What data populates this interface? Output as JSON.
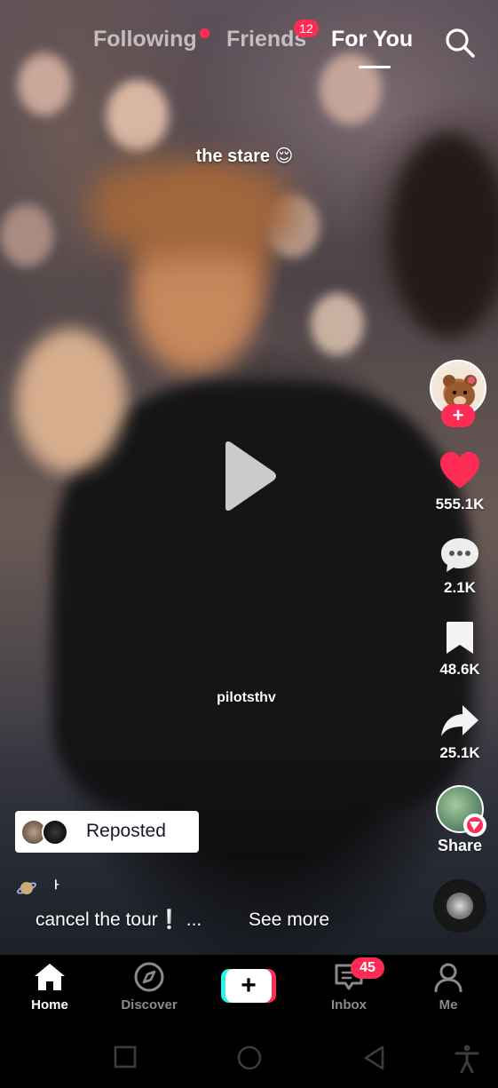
{
  "top_nav": {
    "tabs": [
      {
        "label": "Following",
        "active": false
      },
      {
        "label": "Friends",
        "active": false,
        "badge": "12"
      },
      {
        "label": "For You",
        "active": true
      }
    ],
    "search_icon": "search-icon"
  },
  "video": {
    "caption_overlay": "the stare 😌",
    "watermark": "pilotsthv",
    "play_icon": "play-icon"
  },
  "actions": {
    "avatar_follow": "+",
    "likes": "555.1K",
    "comments": "2.1K",
    "saves": "48.6K",
    "shares": "25.1K",
    "share_label": "Share"
  },
  "post": {
    "reposted_label": "Reposted",
    "emoji_line": "ᅡ",
    "description": "cancel the tour❕ ...",
    "see_more": "See more"
  },
  "bottom_nav": {
    "items": [
      {
        "label": "Home",
        "icon": "home-icon",
        "active": true
      },
      {
        "label": "Discover",
        "icon": "compass-icon",
        "active": false
      },
      {
        "label": "+",
        "icon": "create-icon"
      },
      {
        "label": "Inbox",
        "icon": "inbox-icon",
        "badge": "45"
      },
      {
        "label": "Me",
        "icon": "profile-icon"
      }
    ]
  },
  "colors": {
    "accent": "#fe2c55",
    "cyan": "#25f4ee",
    "inactive_text": "#8a8a8a"
  }
}
